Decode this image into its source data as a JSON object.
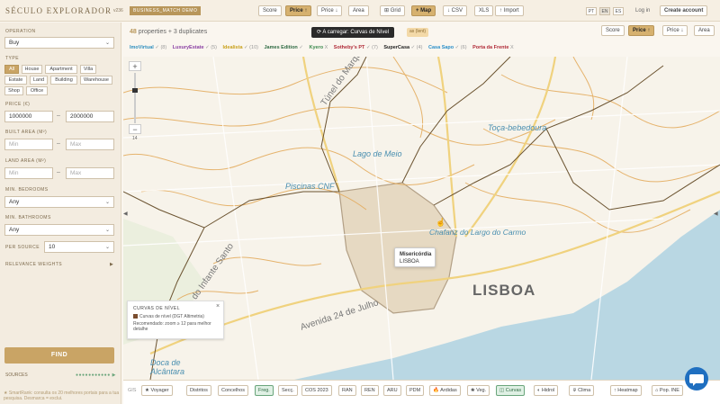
{
  "app": {
    "title": "SÉCULO EXPLORADOR",
    "version": "v236",
    "badge": "BUSINESS_MATCH DEMO"
  },
  "header": {
    "sort_buttons": [
      {
        "label": "Score"
      },
      {
        "label": "Price ↑",
        "active": true
      },
      {
        "label": "Price ↓"
      },
      {
        "label": "Area"
      }
    ],
    "view_buttons": [
      {
        "label": "⊞ Grid"
      },
      {
        "label": "+ Map",
        "active": true
      },
      {
        "label": "↓ CSV"
      },
      {
        "label": "XLS"
      },
      {
        "label": "↑ Import"
      }
    ],
    "languages": [
      "PT",
      "EN",
      "ES"
    ],
    "active_language": "EN",
    "login": "Log in",
    "create_account": "Create account"
  },
  "sidebar": {
    "operation_label": "OPERATION",
    "operation_value": "Buy",
    "type_label": "TYPE",
    "types": [
      {
        "label": "All",
        "active": true
      },
      {
        "label": "House"
      },
      {
        "label": "Apartment"
      },
      {
        "label": "Villa"
      },
      {
        "label": "Estate"
      },
      {
        "label": "Land"
      },
      {
        "label": "Building"
      },
      {
        "label": "Warehouse"
      },
      {
        "label": "Shop"
      },
      {
        "label": "Office"
      }
    ],
    "price_label": "PRICE (€)",
    "price_min": "1000000",
    "price_max": "2000000",
    "built_area_label": "BUILT AREA (M²)",
    "land_area_label": "LAND AREA (M²)",
    "min_placeholder": "Min",
    "max_placeholder": "Max",
    "min_bedrooms_label": "MIN. BEDROOMS",
    "min_bedrooms_value": "Any",
    "min_bathrooms_label": "MIN. BATHROOMS",
    "min_bathrooms_value": "Any",
    "per_source_label": "PER SOURCE",
    "per_source_value": "10",
    "relevance_label": "RELEVANCE WEIGHTS",
    "find_label": "FIND",
    "sources_label": "SOURCES",
    "smartrank_note": "★ SmartRank: consulta os 20 melhores portais para a tua pesquisa. Desmarca = exclui."
  },
  "results": {
    "count_number": "48",
    "count_text": " properties + 3 duplicates",
    "sort_buttons": [
      {
        "label": "Score"
      },
      {
        "label": "Price ↑",
        "active": true
      },
      {
        "label": "Price ↓"
      },
      {
        "label": "Area"
      }
    ],
    "loading_toast": "⟳ A carregar: Curvas de Nível",
    "loading_badge": "as (lent)",
    "sources": [
      {
        "name": "ImoVirtual",
        "status": "✓ (8)",
        "color": "#2f8fbf"
      },
      {
        "name": "LuxuryEstate",
        "status": "✓ (5)",
        "color": "#8a3fa3"
      },
      {
        "name": "Idealista",
        "status": "✓ (10)",
        "color": "#c9a11b"
      },
      {
        "name": "James Edition",
        "status": "✓",
        "color": "#2f6b43"
      },
      {
        "name": "Kyero",
        "status": "X",
        "color": "#3c8a4e"
      },
      {
        "name": "Sotheby's PT",
        "status": "✓ (7)",
        "color": "#b02a37"
      },
      {
        "name": "SuperCasa",
        "status": "✓ (4)",
        "color": "#1f1f1f"
      },
      {
        "name": "Casa Sapo",
        "status": "✓ (6)",
        "color": "#2a8fc9"
      },
      {
        "name": "Porta da Frente",
        "status": "X",
        "color": "#b02a37"
      }
    ]
  },
  "map": {
    "labels": {
      "tunel": "Túnel do Marquês",
      "toca": "Toça-bebedoura",
      "lago": "Lago de Meio",
      "piscinas": "Piscinas CNF",
      "chafariz": "Chafariz do Largo do Carmo",
      "infante": "Av. do Infante Santo",
      "avenida": "Avenida 24 de Julho",
      "lisboa": "LISBOA",
      "alcantara": "Doca de Alcântara",
      "tunel2": "Túnel do Marquês"
    },
    "tooltip": {
      "title": "Misericórdia",
      "subtitle": "LISBOA"
    },
    "legend": {
      "title": "CURVAS DE NÍVEL",
      "item": "Curvas de nível (DGT Altimetria)",
      "note": "Recomendado: zoom ≥ 12 para melhor detalhe"
    },
    "zoom_level": "14"
  },
  "bottombar": {
    "gis_label": "GIS",
    "layers": [
      {
        "label": "★ Voyager"
      },
      {
        "label": "Distritos"
      },
      {
        "label": "Concelhos"
      },
      {
        "label": "Freg."
      },
      {
        "label": "Secç."
      },
      {
        "label": "COS 2023"
      },
      {
        "label": "RAN"
      },
      {
        "label": "REN"
      },
      {
        "label": "ARU"
      },
      {
        "label": "PDM"
      },
      {
        "label": "🔥 Ardidas"
      },
      {
        "label": "❀ Veg."
      },
      {
        "label": "◫ Curvas",
        "active": true
      },
      {
        "label": "◐ Hidrol"
      },
      {
        "label": "⤋ Clima"
      },
      {
        "label": "↑ Heatmap"
      },
      {
        "label": "⌂ Pop. INE"
      }
    ]
  }
}
